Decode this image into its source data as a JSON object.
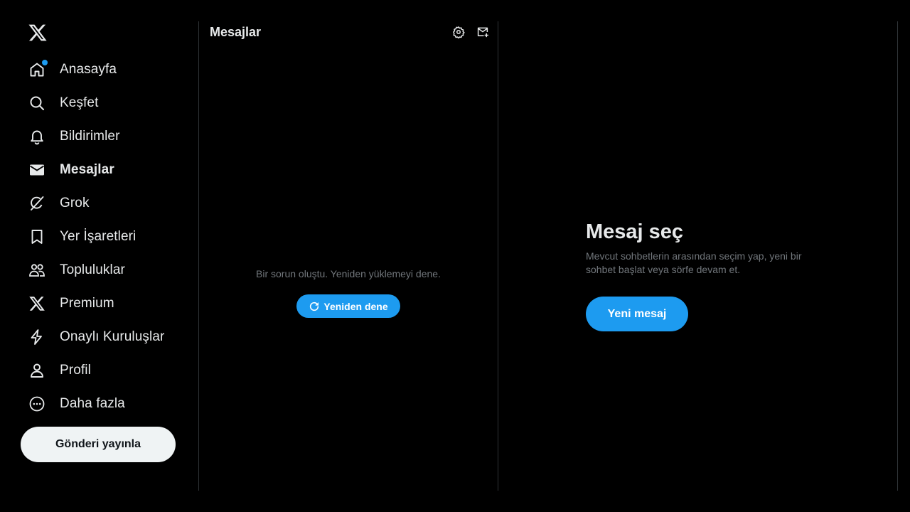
{
  "app": {
    "logo": "x-logo-icon"
  },
  "nav": {
    "items": [
      {
        "label": "Anasayfa",
        "icon": "home-icon",
        "notification_dot": true
      },
      {
        "label": "Keşfet",
        "icon": "search-icon"
      },
      {
        "label": "Bildirimler",
        "icon": "bell-icon"
      },
      {
        "label": "Mesajlar",
        "icon": "envelope-icon",
        "active": true
      },
      {
        "label": "Grok",
        "icon": "grok-icon"
      },
      {
        "label": "Yer İşaretleri",
        "icon": "bookmark-icon"
      },
      {
        "label": "Topluluklar",
        "icon": "communities-icon"
      },
      {
        "label": "Premium",
        "icon": "x-premium-icon"
      },
      {
        "label": "Onaylı Kuruluşlar",
        "icon": "lightning-icon"
      },
      {
        "label": "Profil",
        "icon": "person-icon"
      },
      {
        "label": "Daha fazla",
        "icon": "more-circle-icon"
      }
    ],
    "post_button": "Gönderi yayınla"
  },
  "messages": {
    "title": "Mesajlar",
    "header_icons": [
      "settings-icon",
      "new-message-icon"
    ],
    "error_text": "Bir sorun oluştu. Yeniden yüklemeyi dene.",
    "retry_label": "Yeniden dene"
  },
  "detail": {
    "title": "Mesaj seç",
    "subtitle": "Mevcut sohbetlerin arasından seçim yap, yeni bir sohbet başlat veya sörfe devam et.",
    "new_message_label": "Yeni mesaj"
  },
  "colors": {
    "accent": "#1d9bf0",
    "background": "#000000",
    "text": "#e7e9ea",
    "muted": "#71767b",
    "divider": "#2f3336"
  }
}
